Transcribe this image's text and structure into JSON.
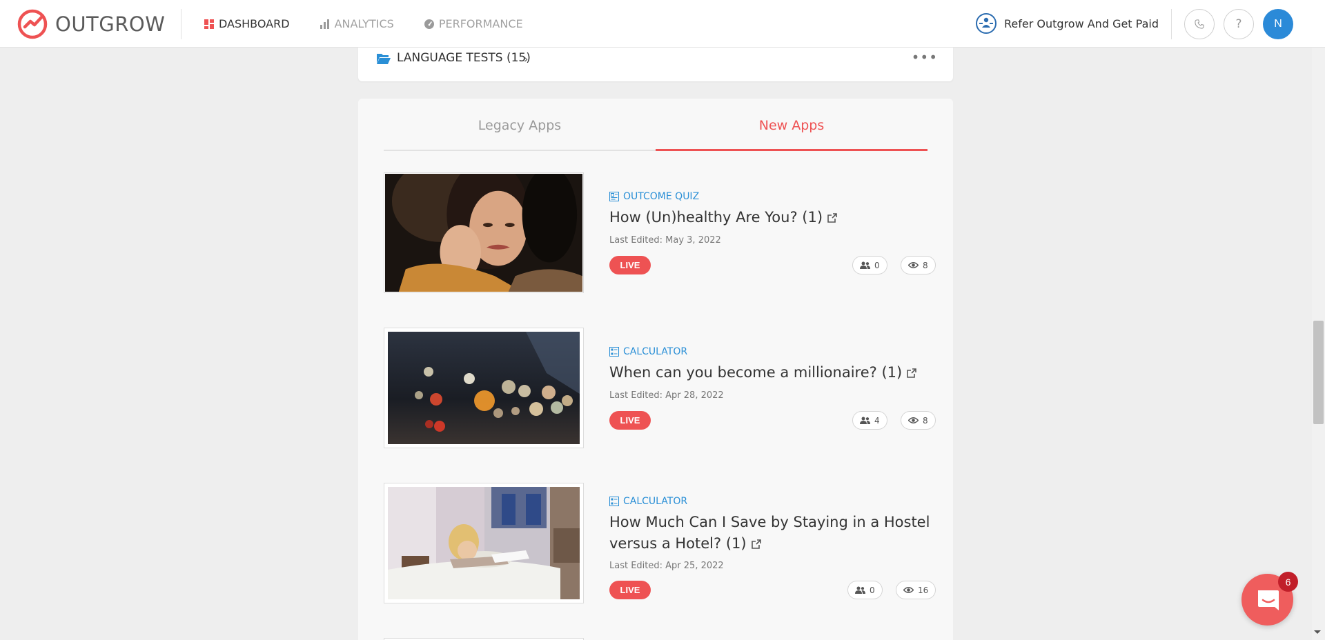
{
  "brand": {
    "name": "OUTGROW",
    "accent": "#ee5253"
  },
  "nav": {
    "items": [
      {
        "label": "DASHBOARD",
        "icon": "dashboard-icon",
        "active": true
      },
      {
        "label": "ANALYTICS",
        "icon": "bar-chart-icon",
        "active": false
      },
      {
        "label": "PERFORMANCE",
        "icon": "speedometer-icon",
        "active": false
      }
    ]
  },
  "header": {
    "refer_label": "Refer Outgrow And Get Paid",
    "help_label": "?",
    "avatar_initial": "N"
  },
  "folder": {
    "name": "LANGUAGE TESTS (15)",
    "more": "•••"
  },
  "tabs": [
    {
      "label": "Legacy Apps",
      "active": false
    },
    {
      "label": "New Apps",
      "active": true
    }
  ],
  "apps": [
    {
      "type": "OUTCOME QUIZ",
      "title": "How (Un)healthy Are You? (1)",
      "edited": "Last Edited: May 3, 2022",
      "status": "LIVE",
      "leads": "0",
      "views": "8"
    },
    {
      "type": "CALCULATOR",
      "title": "When can you become a millionaire? (1)",
      "edited": "Last Edited: Apr 28, 2022",
      "status": "LIVE",
      "leads": "4",
      "views": "8"
    },
    {
      "type": "CALCULATOR",
      "title": "How Much Can I Save by Staying in a Hostel versus a Hotel? (1)",
      "edited": "Last Edited: Apr 25, 2022",
      "status": "LIVE",
      "leads": "0",
      "views": "16"
    }
  ],
  "chat": {
    "unread": "6"
  }
}
